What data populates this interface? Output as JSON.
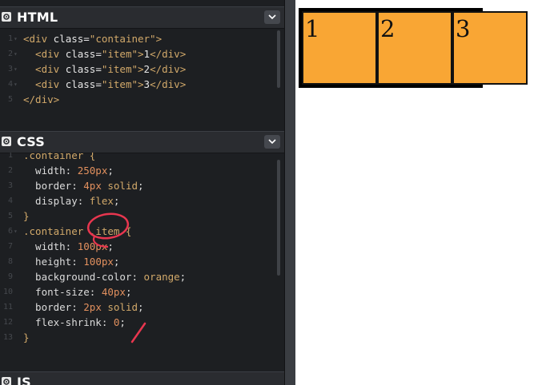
{
  "panels": {
    "html": {
      "title": "HTML",
      "lines": [
        {
          "n": "1",
          "fold": "▾",
          "parts": [
            [
              "t-tag",
              "<div "
            ],
            [
              "t-attr",
              "class="
            ],
            [
              "t-str",
              "\"container\""
            ],
            [
              "t-tag",
              ">"
            ]
          ]
        },
        {
          "n": "2",
          "fold": "▾",
          "parts": [
            [
              "t-tag",
              "  <div "
            ],
            [
              "t-attr",
              "class="
            ],
            [
              "t-str",
              "\"item\""
            ],
            [
              "t-tag",
              ">"
            ],
            [
              "t-attr",
              "1"
            ],
            [
              "t-tag",
              "</div>"
            ]
          ]
        },
        {
          "n": "3",
          "fold": "▾",
          "parts": [
            [
              "t-tag",
              "  <div "
            ],
            [
              "t-attr",
              "class="
            ],
            [
              "t-str",
              "\"item\""
            ],
            [
              "t-tag",
              ">"
            ],
            [
              "t-attr",
              "2"
            ],
            [
              "t-tag",
              "</div>"
            ]
          ]
        },
        {
          "n": "4",
          "fold": "▾",
          "parts": [
            [
              "t-tag",
              "  <div "
            ],
            [
              "t-attr",
              "class="
            ],
            [
              "t-str",
              "\"item\""
            ],
            [
              "t-tag",
              ">"
            ],
            [
              "t-attr",
              "3"
            ],
            [
              "t-tag",
              "</div>"
            ]
          ]
        },
        {
          "n": "5",
          "fold": "",
          "parts": [
            [
              "t-tag",
              "</div>"
            ]
          ]
        }
      ]
    },
    "css": {
      "title": "CSS",
      "lines": [
        {
          "n": "1",
          "fold": "",
          "parts": [
            [
              "t-sel",
              ".container {"
            ]
          ]
        },
        {
          "n": "2",
          "fold": "",
          "parts": [
            [
              "t-prop",
              "  width: "
            ],
            [
              "t-num",
              "250px"
            ],
            [
              "t-prop",
              ";"
            ]
          ]
        },
        {
          "n": "3",
          "fold": "",
          "parts": [
            [
              "t-prop",
              "  border: "
            ],
            [
              "t-num",
              "4px"
            ],
            [
              "t-kw",
              " solid"
            ],
            [
              "t-prop",
              ";"
            ]
          ]
        },
        {
          "n": "4",
          "fold": "",
          "parts": [
            [
              "t-prop",
              "  display: "
            ],
            [
              "t-kw",
              "flex"
            ],
            [
              "t-prop",
              ";"
            ]
          ]
        },
        {
          "n": "5",
          "fold": "",
          "parts": [
            [
              "t-sel",
              "}"
            ]
          ]
        },
        {
          "n": "6",
          "fold": "▾",
          "parts": [
            [
              "t-sel",
              ".container .item {"
            ]
          ]
        },
        {
          "n": "7",
          "fold": "",
          "parts": [
            [
              "t-prop",
              "  width: "
            ],
            [
              "t-num",
              "100px"
            ],
            [
              "t-prop",
              ";"
            ]
          ]
        },
        {
          "n": "8",
          "fold": "",
          "parts": [
            [
              "t-prop",
              "  height: "
            ],
            [
              "t-num",
              "100px"
            ],
            [
              "t-prop",
              ";"
            ]
          ]
        },
        {
          "n": "9",
          "fold": "",
          "parts": [
            [
              "t-prop",
              "  background-color: "
            ],
            [
              "t-kw",
              "orange"
            ],
            [
              "t-prop",
              ";"
            ]
          ]
        },
        {
          "n": "10",
          "fold": "",
          "parts": [
            [
              "t-prop",
              "  font-size: "
            ],
            [
              "t-num",
              "40px"
            ],
            [
              "t-prop",
              ";"
            ]
          ]
        },
        {
          "n": "11",
          "fold": "",
          "parts": [
            [
              "t-prop",
              "  border: "
            ],
            [
              "t-num",
              "2px"
            ],
            [
              "t-kw",
              " solid"
            ],
            [
              "t-prop",
              ";"
            ]
          ]
        },
        {
          "n": "12",
          "fold": "",
          "parts": [
            [
              "t-prop",
              "  flex-shrink: "
            ],
            [
              "t-num",
              "0"
            ],
            [
              "t-prop",
              ";"
            ]
          ]
        },
        {
          "n": "13",
          "fold": "",
          "parts": [
            [
              "t-sel",
              "}"
            ]
          ]
        }
      ]
    },
    "js": {
      "title": "JS"
    }
  },
  "preview": {
    "items": [
      "1",
      "2",
      "3"
    ]
  },
  "colors": {
    "editor_bg": "#1d1f22",
    "item_bg": "#f9a634",
    "annotation": "#e8364f"
  },
  "icons": {
    "panel_menu": "gear-icon",
    "collapse": "chevron-down-icon"
  }
}
